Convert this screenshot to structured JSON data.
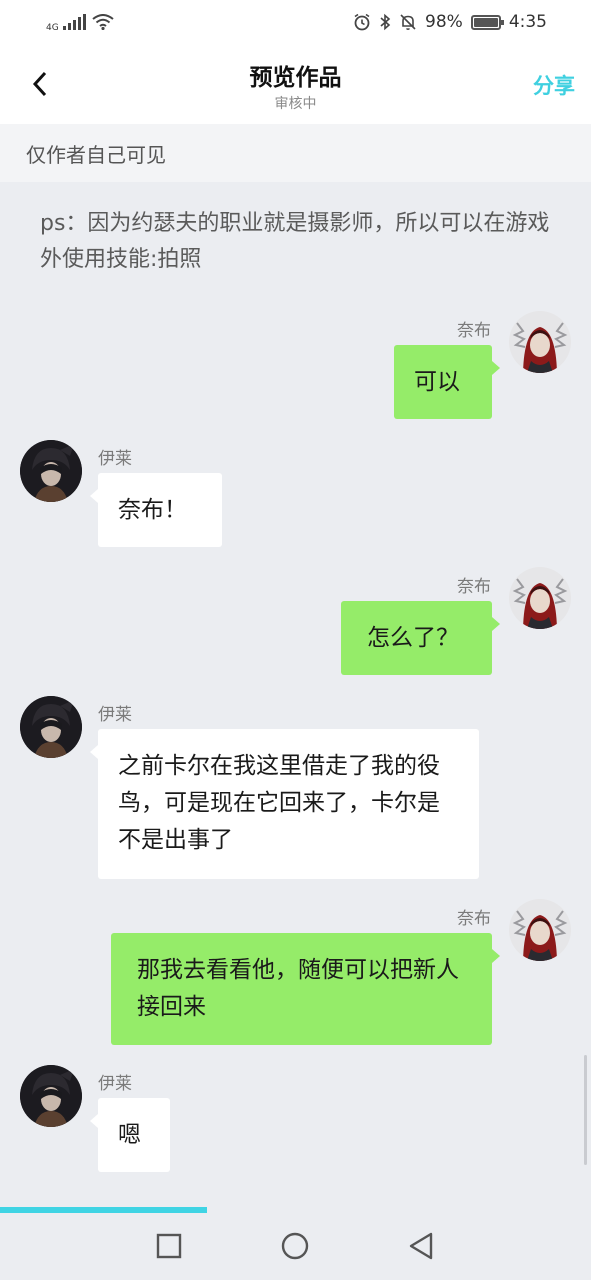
{
  "status_bar": {
    "network": "4G",
    "battery_text": "98%",
    "time": "4:35",
    "icons": [
      "signal-icon",
      "wifi-icon",
      "alarm-icon",
      "bluetooth-icon",
      "mute-bell-icon",
      "battery-icon"
    ]
  },
  "header": {
    "title": "预览作品",
    "subtitle": "审核中",
    "share_label": "分享",
    "accent_color": "#3fd0e0"
  },
  "visibility_notice": "仅作者自己可见",
  "note_text": "ps：因为约瑟夫的职业就是摄影师，所以可以在游戏外使用技能:拍照",
  "messages": [
    {
      "side": "right",
      "sender": "奈布",
      "text": "可以"
    },
    {
      "side": "left",
      "sender": "伊莱",
      "text": "奈布！"
    },
    {
      "side": "right",
      "sender": "奈布",
      "text": "怎么了？"
    },
    {
      "side": "left",
      "sender": "伊莱",
      "text": "之前卡尔在我这里借走了我的役鸟，可是现在它回来了，卡尔是不是出事了"
    },
    {
      "side": "right",
      "sender": "奈布",
      "text": "那我去看看他，随便可以把新人接回来"
    },
    {
      "side": "left",
      "sender": "伊莱",
      "text": "嗯"
    }
  ],
  "colors": {
    "bubble_self": "#95ec69",
    "bubble_other": "#ffffff",
    "background": "#ebedf1"
  },
  "reading_progress": 0.35,
  "system_nav": [
    "recent-apps-icon",
    "home-icon",
    "back-triangle-icon"
  ]
}
